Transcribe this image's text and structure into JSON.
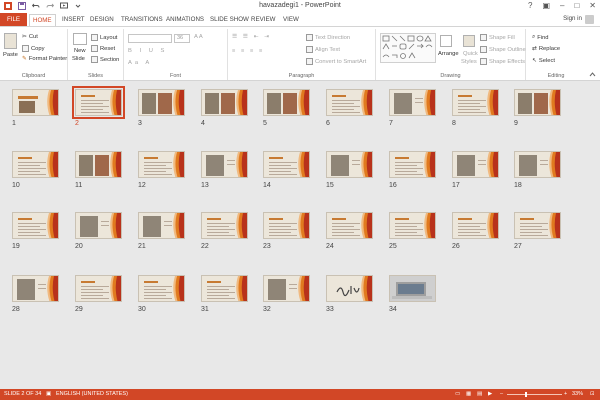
{
  "window": {
    "title": "havazadegi1 - PowerPoint",
    "signin": "Sign in"
  },
  "tabs": [
    "FILE",
    "HOME",
    "INSERT",
    "DESIGN",
    "TRANSITIONS",
    "ANIMATIONS",
    "SLIDE SHOW",
    "REVIEW",
    "VIEW"
  ],
  "ribbon": {
    "clipboard": {
      "label": "Clipboard",
      "paste": "Paste",
      "cut": "Cut",
      "copy": "Copy",
      "format_painter": "Format Painter"
    },
    "slides": {
      "label": "Slides",
      "new_slide": "New",
      "new_slide2": "Slide",
      "layout": "Layout",
      "reset": "Reset",
      "section": "Section"
    },
    "font": {
      "label": "Font",
      "size": "36"
    },
    "paragraph": {
      "label": "Paragraph",
      "text_direction": "Text Direction",
      "align_text": "Align Text",
      "convert": "Convert to SmartArt"
    },
    "drawing": {
      "label": "Drawing",
      "arrange": "Arrange",
      "quick_styles": "Quick",
      "quick_styles2": "Styles",
      "shape_fill": "Shape Fill",
      "shape_outline": "Shape Outline",
      "shape_effects": "Shape Effects"
    },
    "editing": {
      "label": "Editing",
      "find": "Find",
      "replace": "Replace",
      "select": "Select"
    }
  },
  "slides": [
    {
      "n": "1",
      "kind": "title"
    },
    {
      "n": "2",
      "kind": "text",
      "selected": true
    },
    {
      "n": "3",
      "kind": "pics2"
    },
    {
      "n": "4",
      "kind": "pics2"
    },
    {
      "n": "5",
      "kind": "pics2"
    },
    {
      "n": "6",
      "kind": "text"
    },
    {
      "n": "7",
      "kind": "pic1"
    },
    {
      "n": "8",
      "kind": "text"
    },
    {
      "n": "9",
      "kind": "pics2"
    },
    {
      "n": "10",
      "kind": "text"
    },
    {
      "n": "11",
      "kind": "pics2"
    },
    {
      "n": "12",
      "kind": "text"
    },
    {
      "n": "13",
      "kind": "pic1"
    },
    {
      "n": "14",
      "kind": "text"
    },
    {
      "n": "15",
      "kind": "pic1"
    },
    {
      "n": "16",
      "kind": "text"
    },
    {
      "n": "17",
      "kind": "pic1"
    },
    {
      "n": "18",
      "kind": "pic1"
    },
    {
      "n": "19",
      "kind": "text"
    },
    {
      "n": "20",
      "kind": "pic1"
    },
    {
      "n": "21",
      "kind": "pic1"
    },
    {
      "n": "22",
      "kind": "text"
    },
    {
      "n": "23",
      "kind": "text"
    },
    {
      "n": "24",
      "kind": "text"
    },
    {
      "n": "25",
      "kind": "text"
    },
    {
      "n": "26",
      "kind": "text"
    },
    {
      "n": "27",
      "kind": "text"
    },
    {
      "n": "28",
      "kind": "pic1"
    },
    {
      "n": "29",
      "kind": "text"
    },
    {
      "n": "30",
      "kind": "text"
    },
    {
      "n": "31",
      "kind": "text"
    },
    {
      "n": "32",
      "kind": "pic1"
    },
    {
      "n": "33",
      "kind": "calligraphy"
    },
    {
      "n": "34",
      "kind": "photo"
    }
  ],
  "status": {
    "slide": "SLIDE 2 OF 34",
    "language": "ENGLISH (UNITED STATES)",
    "zoom": "33%"
  },
  "colors": {
    "accent": "#d24726",
    "slide_bg": "#ece6da",
    "deco_orange": "#e07a1f"
  }
}
